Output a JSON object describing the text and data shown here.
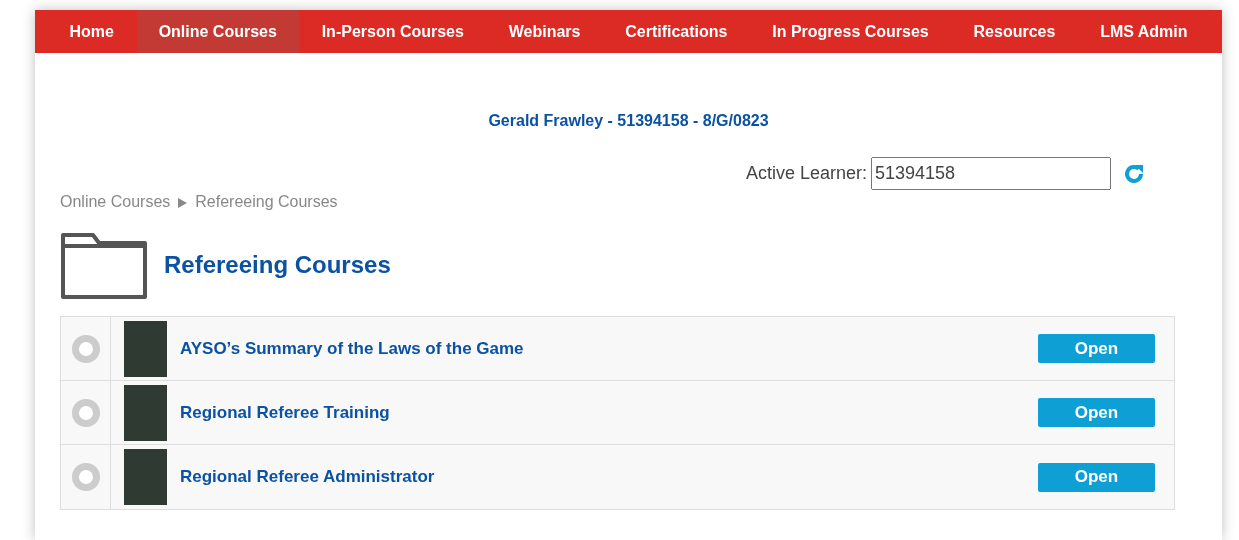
{
  "nav": [
    {
      "label": "Home",
      "selected": false
    },
    {
      "label": "Online Courses",
      "selected": true
    },
    {
      "label": "In-Person Courses",
      "selected": false
    },
    {
      "label": "Webinars",
      "selected": false
    },
    {
      "label": "Certifications",
      "selected": false
    },
    {
      "label": "In Progress Courses",
      "selected": false
    },
    {
      "label": "Resources",
      "selected": false
    },
    {
      "label": "LMS Admin",
      "selected": false
    }
  ],
  "learner_banner": "Gerald Frawley - 51394158 - 8/G/0823",
  "active_learner": {
    "label": "Active Learner:",
    "value": "51394158"
  },
  "breadcrumb": [
    "Online Courses",
    "Refereeing Courses"
  ],
  "heading": "Refereeing Courses",
  "courses": [
    {
      "title": "AYSO’s Summary of the Laws of the Game",
      "selected": false,
      "button": "Open"
    },
    {
      "title": "Regional Referee Training",
      "selected": false,
      "button": "Open"
    },
    {
      "title": "Regional Referee Administrator",
      "selected": false,
      "button": "Open"
    }
  ]
}
